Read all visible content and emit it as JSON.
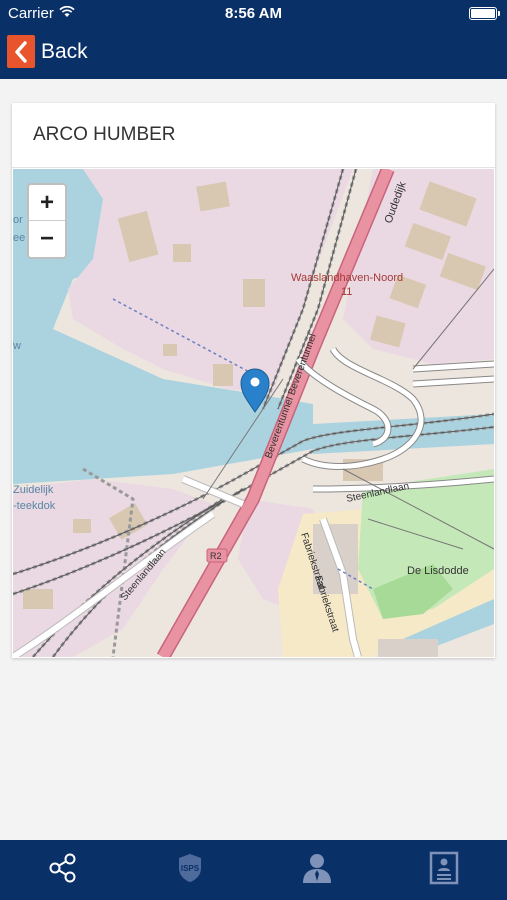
{
  "status_bar": {
    "carrier": "Carrier",
    "time": "8:56 AM"
  },
  "nav": {
    "back_label": "Back"
  },
  "card": {
    "title": "ARCO HUMBER"
  },
  "map": {
    "zoom_in": "+",
    "zoom_out": "−",
    "labels": {
      "area": "Waaslandhaven-Noord",
      "area_number": "11",
      "oudedijk": "Oudedijk",
      "beverentunnel": "Beverentunnel Beverentunnel",
      "steenlandlaan_east": "Steenlandlaan",
      "steenlandlaan_west": "Steenlandlaan",
      "r2": "R2",
      "fabriekstraat_1": "Fabriekstraat",
      "fabriekstraat_2": "Fabriekstraat",
      "de_lisdodde": "De Lisdodde",
      "dok_1": "Zuidelijk",
      "dok_2": "-teekdok",
      "edge_1": "or",
      "edge_2": "ee",
      "edge_3": "w"
    }
  },
  "tabs": [
    {
      "icon": "share-icon"
    },
    {
      "icon": "isps-icon",
      "label": "ISPS"
    },
    {
      "icon": "person-icon"
    },
    {
      "icon": "document-icon"
    }
  ],
  "colors": {
    "bar": "#0a3068",
    "back_button": "#e8542b",
    "marker": "#2a81cb"
  }
}
